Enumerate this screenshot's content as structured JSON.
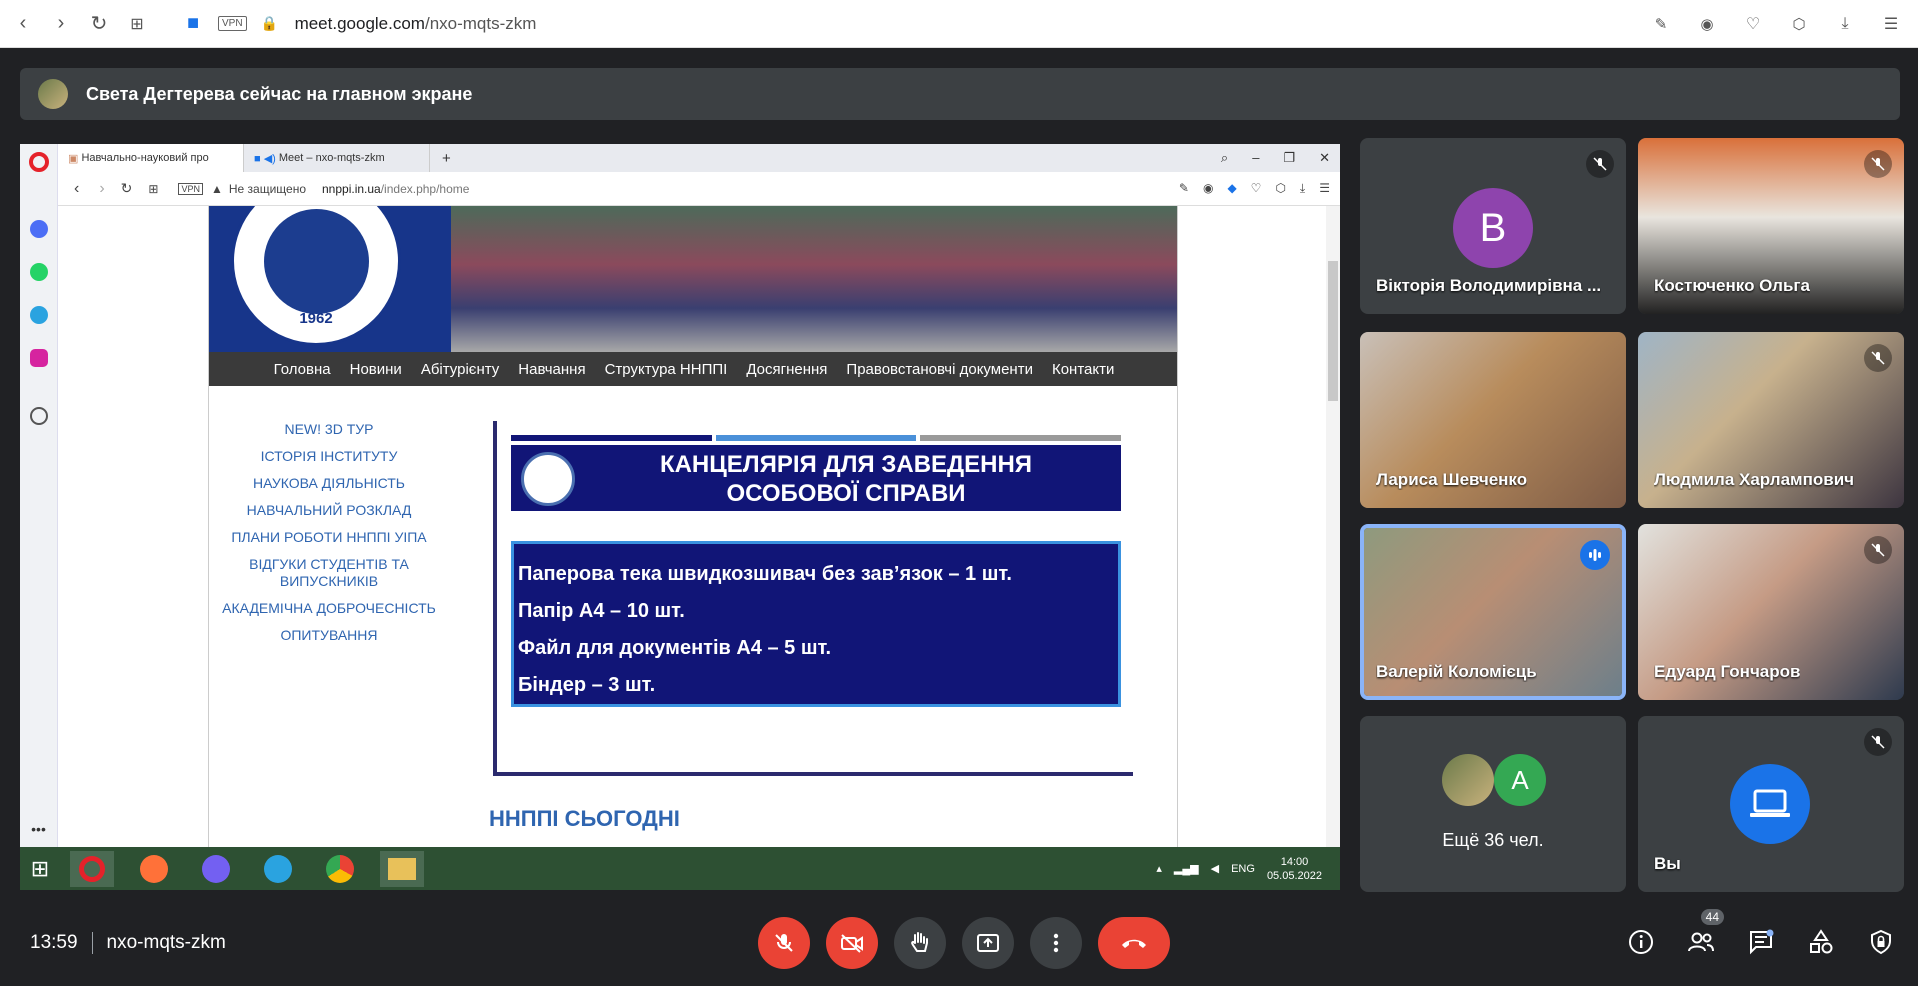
{
  "browser": {
    "url_host": "meet.google.com",
    "url_path": "/nxo-mqts-zkm",
    "vpn_label": "VPN"
  },
  "banner": {
    "text": "Света Дегтерева сейчас на главном экране"
  },
  "shared": {
    "tabs": [
      {
        "label": "Навчально-науковий про"
      },
      {
        "label": "Meet – nxo-mqts-zkm"
      }
    ],
    "address": {
      "security": "Не защищено",
      "host": "nnppi.in.ua",
      "path": "/index.php/home",
      "vpn": "VPN"
    },
    "site": {
      "logo_year": "1962",
      "menu": [
        "Головна",
        "Новини",
        "Абітурієнту",
        "Навчання",
        "Структура ННППІ",
        "Досягнення",
        "Правовстановчі документи",
        "Контакти"
      ],
      "left_nav": [
        "NEW! 3D ТУР",
        "ІСТОРІЯ ІНСТИТУТУ",
        "НАУКОВА ДІЯЛЬНІСТЬ",
        "НАВЧАЛЬНИЙ РОЗКЛАД",
        "ПЛАНИ РОБОТИ ННППІ УІПА",
        "ВІДГУКИ СТУДЕНТІВ ТА ВИПУСКНИКІВ",
        "АКАДЕМІЧНА ДОБРОЧЕСНІСТЬ",
        "ОПИТУВАННЯ"
      ],
      "panel_title_line1": "КАНЦЕЛЯРІЯ ДЛЯ ЗАВЕДЕННЯ",
      "panel_title_line2": "ОСОБОВОЇ СПРАВИ",
      "items": [
        "Паперова тека швидкозшивач без зав’язок – 1 шт.",
        "Папір А4 – 10 шт.",
        "Файл для документів А4 – 5 шт.",
        "Біндер – 3 шт."
      ],
      "today_heading": "ННППІ СЬОГОДНІ"
    },
    "taskbar": {
      "lang": "ENG",
      "time": "14:00",
      "date": "05.05.2022"
    }
  },
  "participants": [
    {
      "name": "Вікторія Володимирівна ...",
      "initial": "В",
      "muted": true
    },
    {
      "name": "Костюченко Ольга",
      "muted": true
    },
    {
      "name": "Лариса Шевченко",
      "muted": false
    },
    {
      "name": "Людмила Харлампович",
      "muted": true
    },
    {
      "name": "Валерій Коломієць",
      "speaking": true
    },
    {
      "name": "Едуард Гончаров",
      "muted": true
    }
  ],
  "more": {
    "label": "Ещё 36 чел.",
    "initial": "A"
  },
  "self": {
    "label": "Вы",
    "muted": true
  },
  "bottom": {
    "time": "13:59",
    "meeting_code": "nxo-mqts-zkm",
    "participants_count": "44"
  },
  "colors": {
    "end_call": "#ea4335",
    "avatar_purple": "#8e44ad",
    "avatar_green": "#34a853",
    "speaking": "#8ab4f8"
  }
}
